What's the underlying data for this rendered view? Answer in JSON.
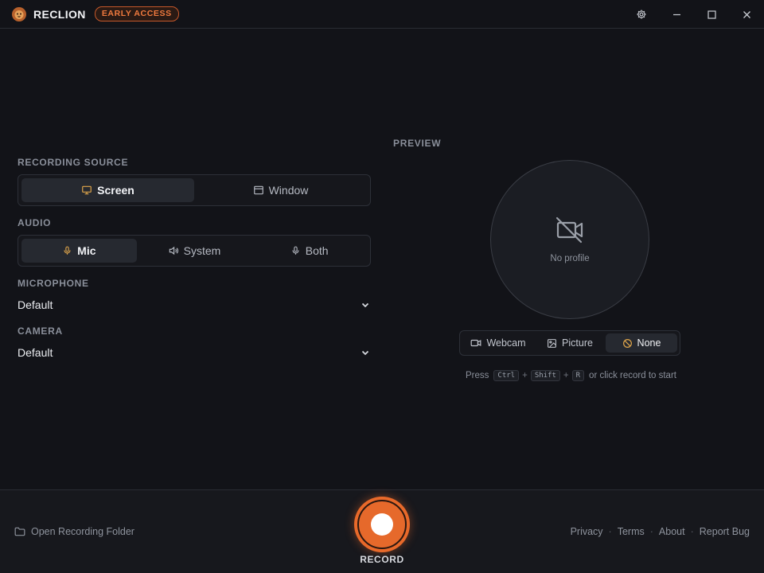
{
  "app": {
    "name": "RECLION",
    "badge": "EARLY ACCESS"
  },
  "titlebar": {
    "icons": [
      "settings-gear-icon",
      "minimize-icon",
      "maximize-icon",
      "close-icon"
    ]
  },
  "recording_source": {
    "label": "RECORDING SOURCE",
    "options": [
      {
        "label": "Screen",
        "icon": "monitor-icon",
        "active": true
      },
      {
        "label": "Window",
        "icon": "window-icon",
        "active": false
      }
    ]
  },
  "audio": {
    "label": "AUDIO",
    "options": [
      {
        "label": "Mic",
        "icon": "microphone-icon",
        "active": true
      },
      {
        "label": "System",
        "icon": "speaker-icon",
        "active": false
      },
      {
        "label": "Both",
        "icon": "microphone-icon",
        "active": false
      }
    ]
  },
  "microphone": {
    "label": "MICROPHONE",
    "value": "Default"
  },
  "camera": {
    "label": "CAMERA",
    "value": "Default"
  },
  "preview": {
    "label": "PREVIEW",
    "empty_text": "No profile",
    "modes": [
      {
        "label": "Webcam",
        "icon": "webcam-icon",
        "active": false
      },
      {
        "label": "Picture",
        "icon": "image-icon",
        "active": false
      },
      {
        "label": "None",
        "icon": "ban-icon",
        "active": true
      }
    ],
    "hint": {
      "prefix": "Press",
      "keys": [
        "Ctrl",
        "Shift",
        "R"
      ],
      "suffix": "or click record to start"
    }
  },
  "footer": {
    "open_folder": "Open Recording Folder",
    "record_label": "RECORD",
    "links": [
      "Privacy",
      "Terms",
      "About",
      "Report Bug"
    ]
  },
  "colors": {
    "accent": "#e8692a",
    "active_icon": "#e0a64b",
    "background": "#121318"
  }
}
